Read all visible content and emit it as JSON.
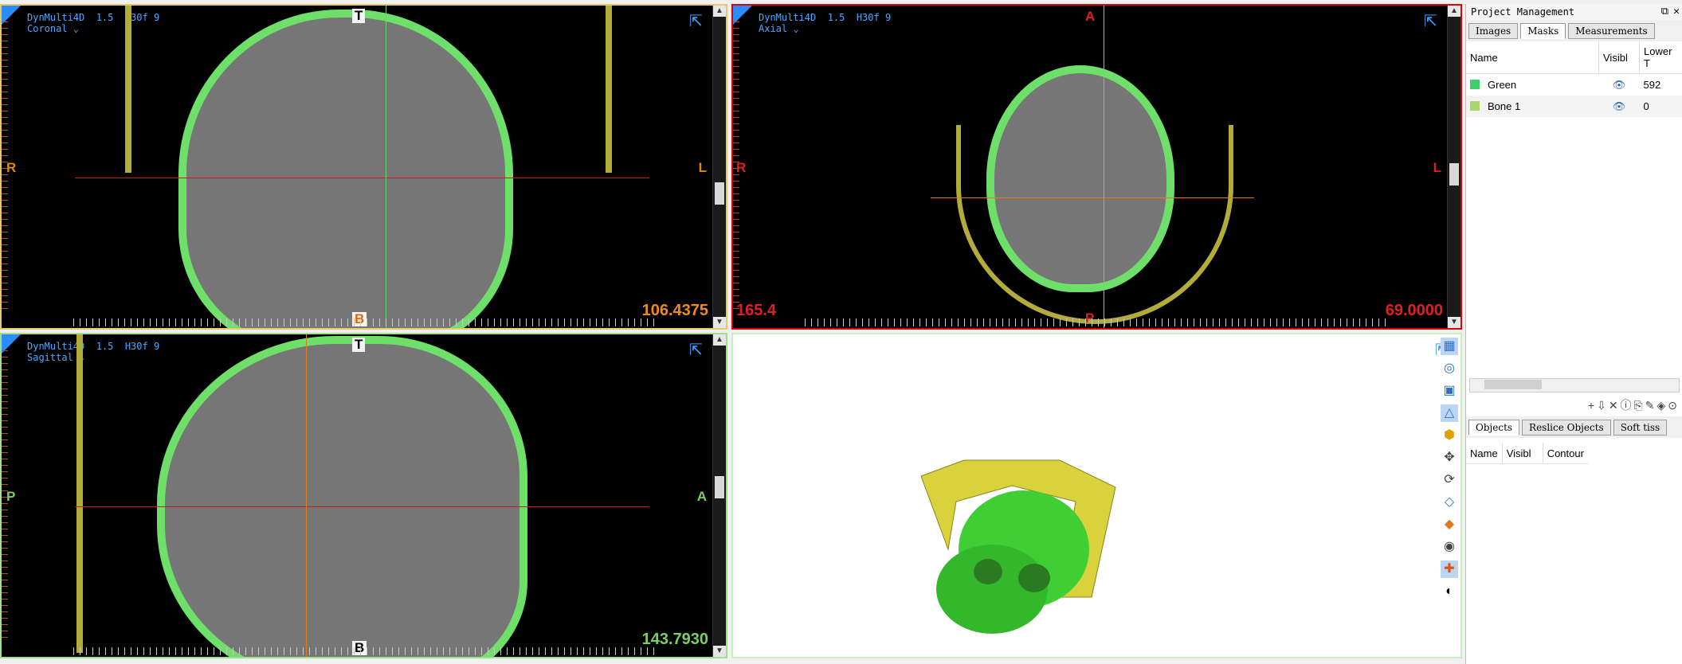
{
  "viewers": {
    "coronal": {
      "header": "DynMulti4D  1.5  H30f 9",
      "plane": "Coronal",
      "top_label": "T",
      "bottom_label": "B",
      "left_label": "R",
      "right_label": "L",
      "value": "106.4375",
      "accent": "#e9c76b"
    },
    "axial": {
      "header": "DynMulti4D  1.5  H30f 9",
      "plane": "Axial",
      "top_label": "A",
      "bottom_label": "P",
      "left_label": "R",
      "right_label": "L",
      "value_left": "165.4",
      "value": "69.0000",
      "accent": "#e00000"
    },
    "sagittal": {
      "header": "DynMulti4D  1.5  H30f 9",
      "plane": "Sagittal",
      "top_label": "T",
      "bottom_label": "B",
      "left_label": "P",
      "right_label": "A",
      "value": "143.7930",
      "accent": "#9fe08a"
    },
    "three_d": {
      "tools": [
        "grid-icon",
        "shapes-icon",
        "crop-icon",
        "measure-icon",
        "mask-icon",
        "pan-icon",
        "rotate-icon",
        "cube-icon",
        "color-icon",
        "eye-icon",
        "axis-icon",
        "contrast-icon"
      ]
    }
  },
  "panel": {
    "title": "Project Management",
    "tabs": [
      "Images",
      "Masks",
      "Measurements"
    ],
    "active_tab": "Masks",
    "mask_columns": [
      "Name",
      "Visibl",
      "Lower T"
    ],
    "masks": [
      {
        "name": "Green",
        "lower": "592",
        "color": "#3ecf6a"
      },
      {
        "name": "Bone 1",
        "lower": "0",
        "color": "#a8d86a"
      }
    ],
    "lower_tabs": [
      "Objects",
      "Reslice Objects",
      "Soft tiss"
    ],
    "active_lower_tab": "Objects",
    "object_columns": [
      "Name",
      "Visibl",
      "Contour"
    ]
  }
}
